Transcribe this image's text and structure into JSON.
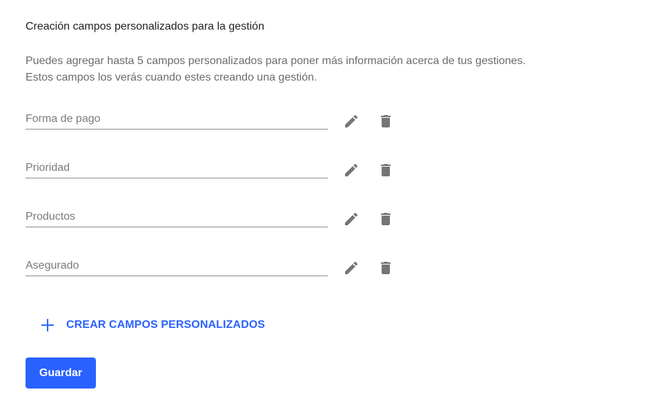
{
  "section": {
    "title": "Creación campos personalizados para la gestión",
    "description_line1": "Puedes agregar hasta 5 campos personalizados para poner más información acerca de tus gestiones.",
    "description_line2": "Estos campos los verás cuando estes creando una gestión."
  },
  "fields": [
    {
      "placeholder": "Forma de pago",
      "value": "",
      "edit_icon": "pencil-icon",
      "delete_icon": "trash-icon"
    },
    {
      "placeholder": "Prioridad",
      "value": "",
      "edit_icon": "pencil-icon",
      "delete_icon": "trash-icon"
    },
    {
      "placeholder": "Productos",
      "value": "",
      "edit_icon": "pencil-icon",
      "delete_icon": "trash-icon"
    },
    {
      "placeholder": "Asegurado",
      "value": "",
      "edit_icon": "pencil-icon",
      "delete_icon": "trash-icon"
    }
  ],
  "actions": {
    "create_label": "CREAR CAMPOS PERSONALIZADOS",
    "create_icon": "plus-icon",
    "save_label": "Guardar"
  },
  "colors": {
    "accent": "#2962ff",
    "icon": "#757575",
    "muted_text": "#6b6b6b"
  }
}
